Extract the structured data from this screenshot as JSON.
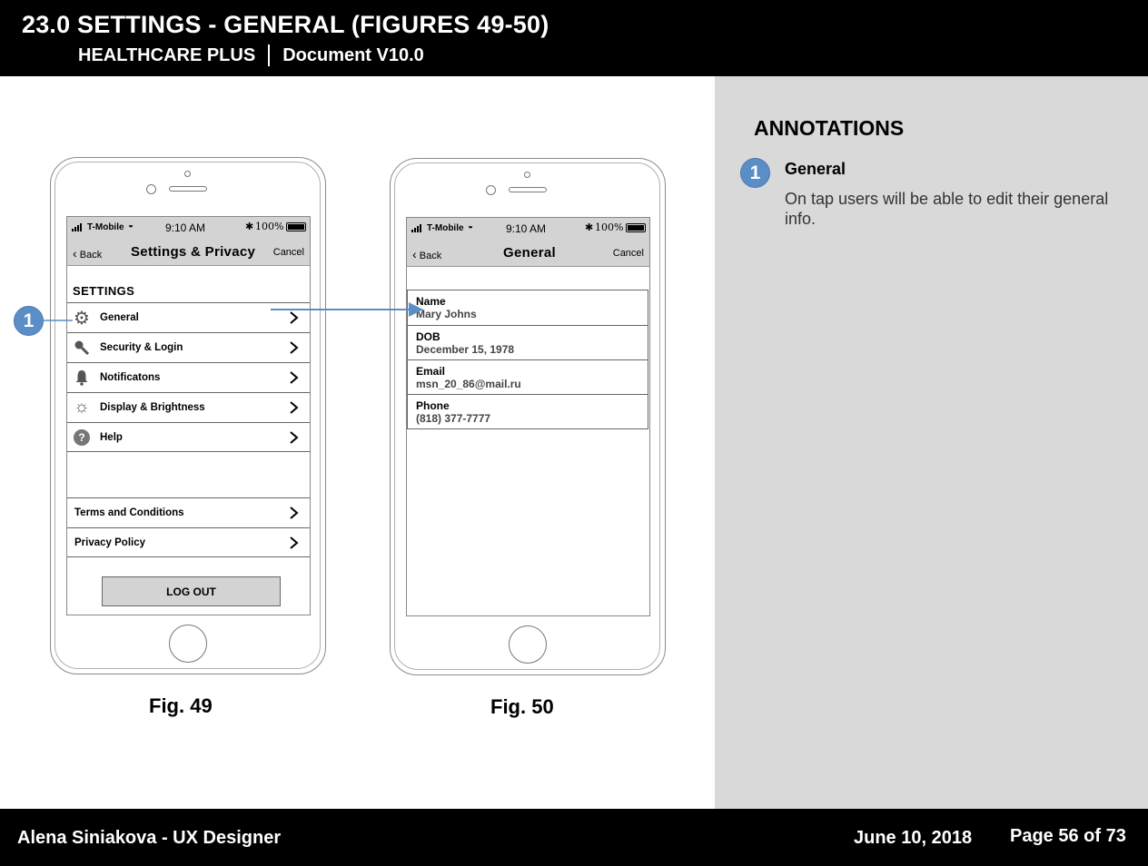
{
  "header": {
    "title": "23.0 SETTINGS - GENERAL  (FIGURES 49-50)",
    "project": "HEALTHCARE PLUS",
    "version": "Document V10.0"
  },
  "annotations": {
    "title": "ANNOTATIONS",
    "items": [
      {
        "number": "1",
        "heading": "General",
        "text": "On tap users will be able to edit their general info."
      }
    ]
  },
  "callout": {
    "number": "1"
  },
  "fig49": {
    "caption": "Fig. 49",
    "status": {
      "carrier": "T-Mobile",
      "time": "9:10 AM",
      "battery": "100%"
    },
    "nav": {
      "back": "Back",
      "title": "Settings & Privacy",
      "cancel": "Cancel"
    },
    "section": "SETTINGS",
    "items": [
      {
        "label": "General",
        "icon": "gear-icon"
      },
      {
        "label": "Security & Login",
        "icon": "key-icon"
      },
      {
        "label": "Notificatons",
        "icon": "bell-icon"
      },
      {
        "label": "Display & Brightness",
        "icon": "sun-icon"
      },
      {
        "label": "Help",
        "icon": "help-icon"
      }
    ],
    "legal": [
      {
        "label": "Terms and Conditions"
      },
      {
        "label": "Privacy Policy"
      }
    ],
    "logout": "LOG OUT"
  },
  "fig50": {
    "caption": "Fig. 50",
    "status": {
      "carrier": "T-Mobile",
      "time": "9:10 AM",
      "battery": "100%"
    },
    "nav": {
      "back": "Back",
      "title": "General",
      "cancel": "Cancel"
    },
    "fields": [
      {
        "label": "Name",
        "value": "Mary Johns"
      },
      {
        "label": "DOB",
        "value": "December 15, 1978"
      },
      {
        "label": "Email",
        "value": "msn_20_86@mail.ru"
      },
      {
        "label": "Phone",
        "value": "(818) 377-7777"
      }
    ]
  },
  "footer": {
    "author": "Alena Siniakova - UX Designer",
    "date": "June 10, 2018",
    "page": "Page 56 of 73"
  },
  "colors": {
    "accent": "#5b8ec6",
    "panel": "#d9d9d9",
    "bar": "#000000",
    "status_bar": "#d3d3d3"
  }
}
